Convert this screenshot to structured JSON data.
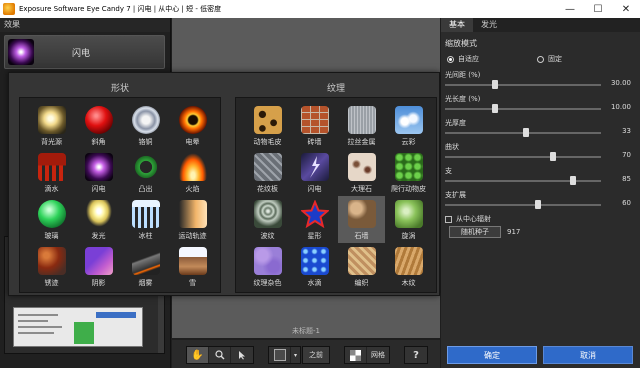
{
  "window": {
    "title": "Exposure Software Eye Candy 7 | 闪电 | 从中心 | 短 - 低密度",
    "minimize": "—",
    "maximize": "☐",
    "close": "✕"
  },
  "left_panel": {
    "section_title": "效果",
    "current_effect_label": "闪电"
  },
  "picker": {
    "shapes_title": "形状",
    "textures_title": "纹理",
    "shapes": [
      {
        "label": "背光源",
        "icon": "backlight-icon"
      },
      {
        "label": "斜角",
        "icon": "bevel-icon"
      },
      {
        "label": "铬铜",
        "icon": "chrome-icon"
      },
      {
        "label": "电晕",
        "icon": "corona-icon"
      },
      {
        "label": "滴水",
        "icon": "drip-icon"
      },
      {
        "label": "闪电",
        "icon": "lightning-icon"
      },
      {
        "label": "凸出",
        "icon": "extrude-icon"
      },
      {
        "label": "火焰",
        "icon": "fire-icon"
      },
      {
        "label": "玻璃",
        "icon": "glass-icon"
      },
      {
        "label": "发光",
        "icon": "glow-icon"
      },
      {
        "label": "冰柱",
        "icon": "icicles-icon"
      },
      {
        "label": "运动轨迹",
        "icon": "motion-trail-icon"
      },
      {
        "label": "锈迹",
        "icon": "rust-icon"
      },
      {
        "label": "阴影",
        "icon": "shadow-icon"
      },
      {
        "label": "烟雾",
        "icon": "smoke-icon"
      },
      {
        "label": "雪",
        "icon": "snow-icon"
      }
    ],
    "textures": [
      {
        "label": "动物毛皮",
        "icon": "animal-fur-icon"
      },
      {
        "label": "砖墙",
        "icon": "brick-wall-icon"
      },
      {
        "label": "拉丝金属",
        "icon": "brushed-metal-icon"
      },
      {
        "label": "云彩",
        "icon": "clouds-icon"
      },
      {
        "label": "花纹板",
        "icon": "diamond-plate-icon"
      },
      {
        "label": "闪电",
        "icon": "lightning-texture-icon"
      },
      {
        "label": "大理石",
        "icon": "marble-icon"
      },
      {
        "label": "爬行动物皮",
        "icon": "reptile-skin-icon"
      },
      {
        "label": "波纹",
        "icon": "ripples-icon"
      },
      {
        "label": "星形",
        "icon": "star-icon"
      },
      {
        "label": "石墙",
        "icon": "stone-wall-icon"
      },
      {
        "label": "旋涡",
        "icon": "swirl-icon"
      },
      {
        "label": "纹理杂色",
        "icon": "texture-noise-icon"
      },
      {
        "label": "水滴",
        "icon": "water-drops-icon"
      },
      {
        "label": "编织",
        "icon": "weave-icon"
      },
      {
        "label": "木纹",
        "icon": "wood-icon"
      }
    ],
    "selected_texture": "石墙"
  },
  "canvas": {
    "document_label": "未标题-1"
  },
  "toolbar": {
    "hand_icon": "✋",
    "zoom_icon": "🔍",
    "pointer_icon": "➤",
    "before_label": "之前",
    "grid_label": "网格",
    "help_icon": "?"
  },
  "right_panel": {
    "tabs": [
      "基本",
      "发光"
    ],
    "active_tab": "基本",
    "mode_title": "缩放模式",
    "mode_options": [
      "自适应",
      "固定"
    ],
    "params": [
      {
        "label": "光间距 (%)",
        "value": "30.00",
        "level": 0.31
      },
      {
        "label": "光长度 (%)",
        "value": "10.00",
        "level": 0.31
      },
      {
        "label": "光厚度",
        "value": "33",
        "level": 0.52
      },
      {
        "label": "曲状",
        "value": "70",
        "level": 0.7
      },
      {
        "label": "支",
        "value": "85",
        "level": 0.83
      },
      {
        "label": "支扩展",
        "value": "60",
        "level": 0.6
      }
    ],
    "from_center_label": "从中心辐射",
    "random_seed_label": "随机种子",
    "random_seed_value": "917",
    "ok_label": "确定",
    "cancel_label": "取消"
  },
  "colors": {
    "accent": "#2f6ac9",
    "panel": "#2b2b2b",
    "canvas": "#5b5b5b"
  }
}
